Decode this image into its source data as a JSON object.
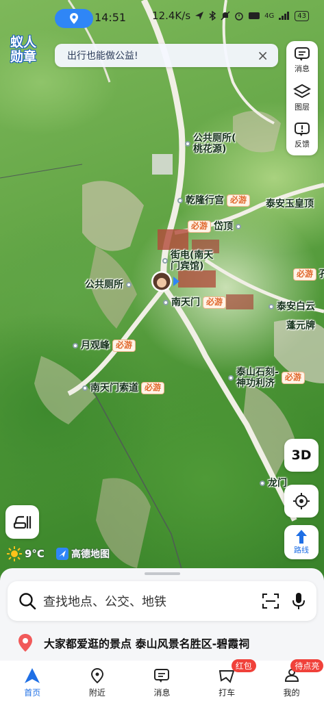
{
  "status_bar": {
    "time": "14:51",
    "network_speed": "12.4K/s",
    "network_type": "4G",
    "battery": "43"
  },
  "brand_logo": "蚁人\n勋章",
  "banner": {
    "text": "出行也能做公益!",
    "close": "×"
  },
  "side_panel": {
    "messages": "消息",
    "layers": "图层",
    "feedback": "反馈"
  },
  "map": {
    "must_visit_label": "必游",
    "pois": [
      {
        "name": "公共厕所(\n桃花源)",
        "must": false
      },
      {
        "name": "乾隆行宫",
        "must": true
      },
      {
        "name": "泰安玉皇顶",
        "must": false
      },
      {
        "name": "岱顶",
        "must": true
      },
      {
        "name": "街电(南天\n门宾馆)",
        "must": false
      },
      {
        "name": "公共厕所",
        "must": false
      },
      {
        "name": "南天门",
        "must": true
      },
      {
        "name": "孔",
        "must": true
      },
      {
        "name": "泰安白云",
        "must": false
      },
      {
        "name": "蓬元牌",
        "must": false
      },
      {
        "name": "月观峰",
        "must": true
      },
      {
        "name": "泰山石刻-\n神功利济",
        "must": true
      },
      {
        "name": "南天门索道",
        "must": true
      },
      {
        "name": "龙门",
        "must": false
      }
    ]
  },
  "controls": {
    "three_d": "3D",
    "route": "路线"
  },
  "weather": {
    "temp": "9°C"
  },
  "map_provider": "高德地图",
  "search": {
    "placeholder": "查找地点、公交、地铁"
  },
  "recommendation": "大家都爱逛的景点 泰山风景名胜区-碧霞祠",
  "tabs": [
    {
      "label": "首页",
      "badge": ""
    },
    {
      "label": "附近",
      "badge": ""
    },
    {
      "label": "消息",
      "badge": ""
    },
    {
      "label": "打车",
      "badge": "红包"
    },
    {
      "label": "我的",
      "badge": "待点亮"
    }
  ],
  "colors": {
    "accent": "#1f6fe5",
    "location_pill": "#2f86f6",
    "must_visit_text": "#e0662b",
    "badge_red": "#f0413a"
  }
}
